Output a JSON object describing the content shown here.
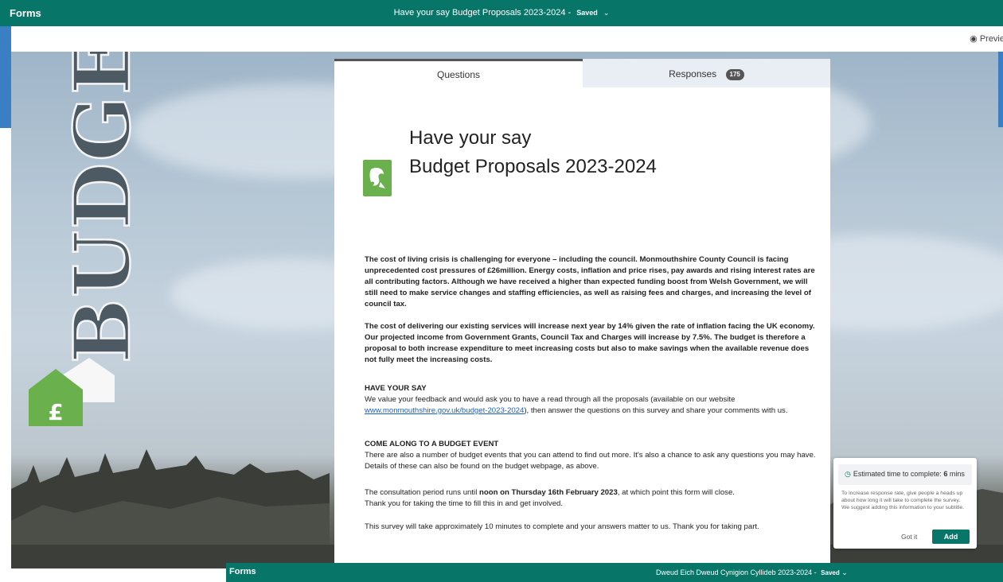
{
  "app": {
    "name": "Forms"
  },
  "topbar": {
    "title": "Have your say  Budget Proposals 2023-2024",
    "separator": "-",
    "saved": "Saved"
  },
  "subbar": {
    "preview": "Previe"
  },
  "background": {
    "banner_word": "BUDGET",
    "house_symbol": "£",
    "colors": {
      "green": "#6ab04c",
      "slate": "#4d5a63"
    }
  },
  "tabs": {
    "questions": "Questions",
    "responses": "Responses",
    "responses_count": "175"
  },
  "form": {
    "title_line1": "Have your say",
    "title_line2": "Budget Proposals 2023-2024",
    "p1": "The cost of living crisis is challenging for everyone – including the council. Monmouthshire County Council is facing unprecedented cost pressures of £26million. Energy costs, inflation and price rises, pay awards and rising interest rates are all contributing factors. Although we have received a higher than expected funding boost from Welsh Government, we will still need to make service changes and staffing efficiencies, as well as raising fees and charges, and increasing the level of council tax.",
    "p2": "The cost of delivering our existing services will increase next year by 14% given the rate of inflation facing the UK economy. Our projected income from Government Grants, Council Tax and Charges will increase by 7.5%. The budget is therefore a proposal to both increase expenditure to meet increasing costs but also to make savings when the available revenue does not fully meet the increasing costs.",
    "h3": "HAVE YOUR SAY",
    "p3_start": " We value your feedback and would ask you to have a read through all the proposals (available on our website ",
    "p3_link": "www.monmouthshire.gov.uk/budget-2023-2024",
    "p3_end": "), then answer the questions on this survey and share your comments with us.",
    "h4": "COME ALONG TO A BUDGET EVENT",
    "p4": "There are also a number of budget events that you can attend to find out more. It's also a chance to ask any questions you may have. Details of these can also be found on the budget webpage, as above.",
    "p5_start": "The consultation period runs until ",
    "p5_bold": "noon on Thursday 16th February 2023",
    "p5_end": ", at which point this form will close.",
    "p5_line2": "Thank you for taking the time to fill this in and get involved.",
    "p6": "This survey will take approximately 10 minutes to complete and your answers matter to us. Thank you for taking part."
  },
  "popover": {
    "head": "Estimated time to complete: ",
    "minutes": "6",
    "unit": " mins",
    "text": "To increase response rate, give people a heads up about how long it will take to complete the survey. We suggest adding this information to your subtitle.",
    "got_it": "Got it",
    "add": "Add"
  },
  "bottombar": {
    "brand": "Forms",
    "title": "Dweud Eich Dweud  Cynigion Cyllideb 2023-2024",
    "separator": "-",
    "saved": "Saved"
  }
}
